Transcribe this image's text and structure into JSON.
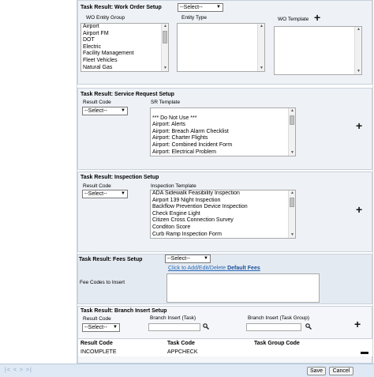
{
  "wo_setup": {
    "title": "Task Result: Work Order Setup",
    "select_value": "--Select--",
    "entity_group_label": "WO Entity Group",
    "entity_type_label": "Entity Type",
    "template_label": "WO Template",
    "entity_groups": [
      "Airport",
      "Airport FM",
      "DOT",
      "Electric",
      "Facility Management",
      "Fleet Vehicles",
      "Natural Gas"
    ]
  },
  "sr_setup": {
    "title": "Task Result: Service Request Setup",
    "result_code_label": "Result Code",
    "result_code_value": "--Select--",
    "template_label": "SR Template",
    "templates": [
      "",
      "*** Do Not Use ***",
      "Airport: Alerts",
      "Airport: Breach Alarm Checklist",
      "Airport: Charter Flights",
      "Airport: Combined Incident Form",
      "Airport: Electrical Problem"
    ]
  },
  "insp_setup": {
    "title": "Task Result: Inspection Setup",
    "result_code_label": "Result Code",
    "result_code_value": "--Select--",
    "template_label": "Inspection Template",
    "templates": [
      "ADA Sidewalk Feasibility Inspection",
      "Airport 139 Night Inspection",
      "Backflow Prevention Device Inspection",
      "Check Engine Light",
      "Citizen Cross Connection Survey",
      "Conditon Score",
      "Curb Ramp Inspection Form"
    ]
  },
  "fees_setup": {
    "title": "Task Result: Fees Setup",
    "select_value": "--Select--",
    "link_prefix": "Click to Add/Edit/Delete",
    "link_bold": "Default Fees",
    "fee_codes_label": "Fee Codes to Insert"
  },
  "branch_setup": {
    "title": "Task Result: Branch Insert Setup",
    "result_code_label": "Result Code",
    "result_code_value": "--Select--",
    "branch_task_label": "Branch Insert (Task)",
    "branch_group_label": "Branch Insert (Task Group)",
    "columns": [
      "Result Code",
      "Task Code",
      "Task Group Code"
    ],
    "rows": [
      {
        "result_code": "INCOMPLETE",
        "task_code": "APPCHECK",
        "task_group_code": ""
      }
    ]
  },
  "footer": {
    "pager": "|< < > >|",
    "save_label": "Save",
    "cancel_label": "Cancel"
  },
  "colors": {
    "panel_bg": "#eef2f6",
    "footer_bg": "#dfe9f5",
    "link": "#2a6ab8"
  }
}
